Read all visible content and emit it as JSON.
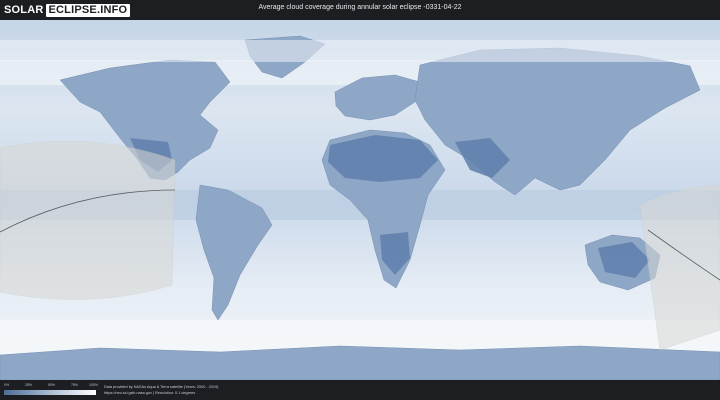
{
  "header": {
    "logo": {
      "part1": "SOLAR",
      "part2": "ECLIPSE.INFO"
    },
    "title": "Average cloud coverage during annular solar eclipse -0331-04-22"
  },
  "legend": {
    "ticks": [
      "0%",
      "25%",
      "50%",
      "75%",
      "100%"
    ],
    "colors": [
      "#4d6d96",
      "#8aa2c0",
      "#c9d5e4",
      "#ffffff"
    ]
  },
  "credits": {
    "line1": "Data provided by NASAs Aqua & Terra satellite (Years: 2000 - 2019)",
    "line2": "https://neo.sci.gsfc.nasa.gov | Resolution: 0.1 degrees"
  },
  "colors": {
    "background": "#1c1e22",
    "ocean": "#dfe8f2",
    "land_clear": "#6f8cb4",
    "eclipse_zone": "#d8d8d4",
    "path": "#5a5e66"
  }
}
